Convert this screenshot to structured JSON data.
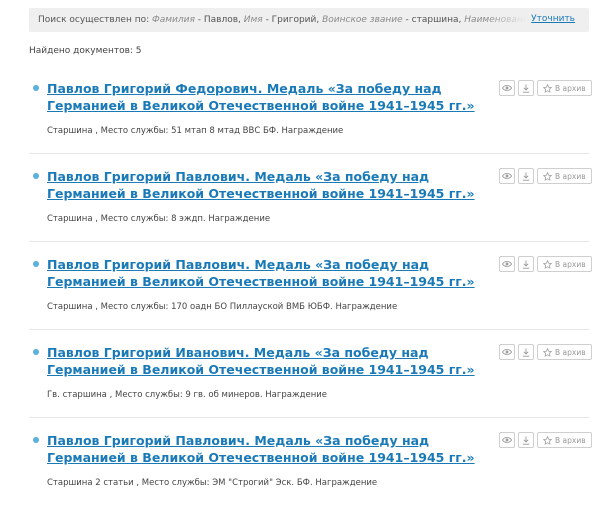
{
  "search": {
    "prefix": "Поиск осуществлен по:",
    "criteria": [
      {
        "field": "Фамилия",
        "value": "Павлов"
      },
      {
        "field": "Имя",
        "value": "Григорий"
      },
      {
        "field": "Воинское звание",
        "value": "старшина"
      },
      {
        "field": "Наименование награ...",
        "value": ""
      }
    ],
    "separator": " - ",
    "refine_label": "Уточнить"
  },
  "found_label": "Найдено документов: 5",
  "actions": {
    "view_icon": "eye-icon",
    "download_icon": "download-icon",
    "archive_icon": "star-icon",
    "archive_label": "В архив"
  },
  "results": [
    {
      "title": "Павлов Григорий Федорович. Медаль «За победу над Германией в Великой Отечественной войне 1941–1945 гг.»",
      "meta": "Старшина , Место службы: 51 мтап 8 мтад ВВС БФ. Награждение"
    },
    {
      "title": "Павлов Григорий Павлович. Медаль «За победу над Германией в Великой Отечественной войне 1941–1945 гг.»",
      "meta": "Старшина , Место службы: 8 эждп. Награждение"
    },
    {
      "title": "Павлов Григорий Павлович. Медаль «За победу над Германией в Великой Отечественной войне 1941–1945 гг.»",
      "meta": "Старшина , Место службы: 170 оадн БО Пиллауской ВМБ ЮБФ. Награждение"
    },
    {
      "title": "Павлов Григорий Иванович. Медаль «За победу над Германией в Великой Отечественной войне 1941–1945 гг.»",
      "meta": "Гв. старшина , Место службы: 9 гв. об минеров. Награждение"
    },
    {
      "title": "Павлов Григорий Павлович. Медаль «За победу над Германией в Великой Отечественной войне 1941–1945 гг.»",
      "meta": "Старшина 2 статьи , Место службы: ЭМ \"Строгий\" Эск. БФ. Награждение"
    }
  ]
}
